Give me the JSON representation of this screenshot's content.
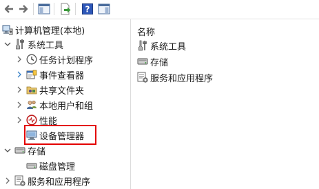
{
  "toolbar": {
    "buttons": [
      {
        "name": "back-icon"
      },
      {
        "name": "forward-icon"
      },
      {
        "name": "show-hide-console-tree-icon"
      },
      {
        "name": "export-list-icon"
      },
      {
        "name": "help-icon"
      },
      {
        "name": "show-hide-action-pane-icon"
      }
    ]
  },
  "tree": {
    "root": {
      "label": "计算机管理(本地)",
      "icon": "computer-management-icon"
    },
    "system_tools": {
      "label": "系统工具",
      "icon": "system-tools-icon"
    },
    "task_scheduler": {
      "label": "任务计划程序",
      "icon": "clock-icon"
    },
    "event_viewer": {
      "label": "事件查看器",
      "icon": "event-viewer-icon"
    },
    "shared_folders": {
      "label": "共享文件夹",
      "icon": "shared-folder-icon"
    },
    "local_users": {
      "label": "本地用户和组",
      "icon": "users-icon"
    },
    "performance": {
      "label": "性能",
      "icon": "performance-icon"
    },
    "device_manager": {
      "label": "设备管理器",
      "icon": "device-manager-icon"
    },
    "storage": {
      "label": "存储",
      "icon": "storage-icon"
    },
    "disk_management": {
      "label": "磁盘管理",
      "icon": "disk-icon"
    },
    "services_apps": {
      "label": "服务和应用程序",
      "icon": "services-apps-icon"
    }
  },
  "list": {
    "column_name": "名称",
    "items": [
      {
        "label": "系统工具",
        "icon": "system-tools-icon"
      },
      {
        "label": "存储",
        "icon": "storage-icon"
      },
      {
        "label": "服务和应用程序",
        "icon": "services-apps-icon"
      }
    ]
  },
  "colors": {
    "highlight": "#e30000",
    "divider": "#dcdcdc"
  }
}
